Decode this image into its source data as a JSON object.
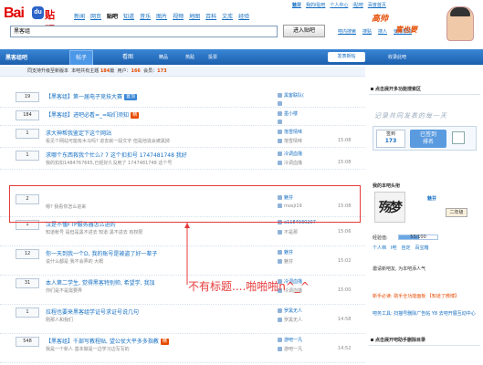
{
  "brand": {
    "logo_text": "Bai",
    "logo_paw": "du",
    "logo_suffix": "贴吧"
  },
  "nav": [
    "新闻",
    "网页",
    "贴吧",
    "知道",
    "音乐",
    "图片",
    "视频",
    "地图",
    "百科",
    "文库",
    "经验"
  ],
  "nav_current": "贴吧",
  "user_links": [
    "魅芬",
    "我的i贴吧",
    "个人中心",
    "i贴吧",
    "百度首页"
  ],
  "search": {
    "value": "黑客组",
    "button": "进入贴吧"
  },
  "search_links": [
    "吧内搜索",
    "搜贴",
    "搜人",
    "使用帮助"
  ],
  "banner": {
    "line1": "高帅",
    "line2": "富也要"
  },
  "forumbar": {
    "name": "黑客组吧",
    "tab1": "帖子",
    "tab2": "看图",
    "tab3": "精品",
    "tab4": "热贴",
    "tab5": "投票",
    "post": "发表新帖",
    "fav": "收录此吧"
  },
  "stats": {
    "prefix": "同支持升级至新版本",
    "topics_label": "本吧共有主题",
    "topics": "184",
    "topics_suffix": "篇",
    "posts_label": "用户：",
    "posts": "166",
    "members_label": "会员：",
    "members": "173"
  },
  "threads": [
    {
      "reply": "19",
      "title": "【黑客组】第一届电子竞技大赛",
      "tag": "置顶",
      "tag_color": "#3a86d6",
      "sub": "",
      "author": "黑客联队(",
      "lastr": "",
      "time": ""
    },
    {
      "reply": "184",
      "title": "【黑客组】进吧必看=_=咱们须知",
      "tag": "精",
      "tag_color": "#e64b00",
      "sub": "",
      "author": "墨小楼",
      "lastr": "",
      "time": ""
    },
    {
      "reply": "1",
      "title": "求大神帮我鉴定下这个网站",
      "tag": "",
      "tag_color": "",
      "sub": "看见个网站可能有木马吗? 进去就一段文字 但是他说会被黑掉",
      "author": "落雪情味",
      "lastr": "落雪情味",
      "time": "15:08"
    },
    {
      "reply": "1",
      "title": "求哪个东西救我个忙么? 7 这个扣扣号 1747481748 我好",
      "tag": "",
      "tag_color": "",
      "sub": "我的扣扣1484767665,已经好久没用了 1747481748 这个号",
      "author": "冷调血撸",
      "lastr": "冷调血撸",
      "time": "15:08"
    },
    {
      "reply": "2",
      "title": "",
      "tag": "",
      "tag_color": "",
      "sub": "嗯? 我看你怎么进来",
      "author": "魅芬",
      "lastr": "mosji19",
      "time": "15:08"
    },
    {
      "reply": "1",
      "title": "汉是不懂FTP服务器怎么进的",
      "tag": "",
      "tag_color": "",
      "sub": "知道帐号 是但是黑不进去 知道 黑不进去 有权限",
      "author": "a1184930207",
      "lastr": "不是那",
      "time": "15:06"
    },
    {
      "reply": "12",
      "title": "你一天到我一个D, 我的账号是被盗了好一辈子",
      "tag": "",
      "tag_color": "",
      "sub": "说什么都是 我不会弄的 大概",
      "author": "魅芬",
      "lastr": "魅芬",
      "time": "15:02"
    },
    {
      "reply": "31",
      "title": "本人第二学生, 觉得黑客特别帅, 希望学, 我加",
      "tag": "",
      "tag_color": "",
      "sub": "你们是不是需要弄",
      "author": "冷调血撸",
      "lastr": "冷调血撸",
      "time": "15:00"
    },
    {
      "reply": "1",
      "title": "拉程也要来黑客组学证号求证号说几句",
      "tag": "",
      "tag_color": "",
      "sub": "刚那人和我们",
      "author": "罗黑无人",
      "lastr": "罗黑无人",
      "time": "14:58"
    },
    {
      "reply": "548",
      "title": "【黑客组】千部写教程贴, 望公仗大平多多指教",
      "tag": "精",
      "tag_color": "#e64b00",
      "sub": "我是一个新人 基本做是一边学习边写写的",
      "author": "游吧一凡",
      "lastr": "游吧一凡",
      "time": "14:52"
    }
  ],
  "annotation": "不有标题....啪啪啪n^_^",
  "sidebar": {
    "head1": "点击展开多功能搜索区",
    "motto": "记录共同发表的每一天",
    "sign_label": "签到",
    "sign_days": "173",
    "sign_status": "已签到",
    "sign_rank": "排名",
    "myinfo": "我的本吧头衔",
    "avatar_text": "殇梦",
    "uname": "魅芬",
    "level": "二年级",
    "exp_label": "经验值:",
    "exp_value": "53/100",
    "exp_fraction": 0.53,
    "links": [
      "个人档",
      "I吧",
      "自定",
      "百宝箱"
    ],
    "line1": "邀请新吧友, 为本吧添人气",
    "line2": "新手必读: 助手全功能面板 【知道了微博】",
    "line3": "吧务工具: 扫描号删除广告帖 Y8 去吧开展互动中心",
    "line4": "点击展开吧助手删除目录",
    "head2": "点击展开吧助手删除目录"
  }
}
